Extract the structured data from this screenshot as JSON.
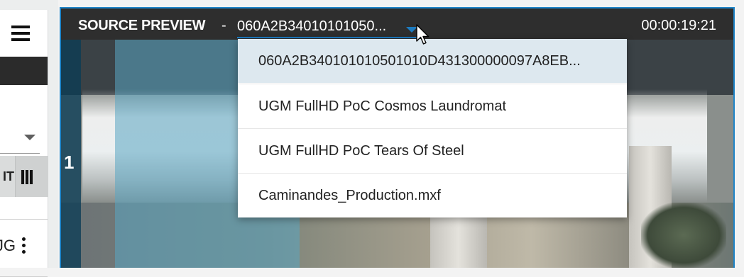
{
  "preview": {
    "title": "SOURCE PREVIEW",
    "separator": "-",
    "selected_source": "060A2B34010101050...",
    "timecode": "00:00:19:21",
    "track_number": "1"
  },
  "dropdown": {
    "options": [
      "060A2B340101010501010D431300000097A8EB...",
      "UGM FullHD PoC Cosmos Laundromat",
      "UGM FullHD PoC Tears Of Steel",
      "Caminandes_Production.mxf"
    ],
    "selected_index": 0
  },
  "left_panel": {
    "button_text": "IT",
    "item_text": "JG"
  },
  "colors": {
    "accent": "#1f84c8",
    "header_bg": "#2e2e2e",
    "selected_option_bg": "#dde8ef"
  },
  "icons": [
    "menu-icon",
    "chevron-down-icon",
    "columns-icon",
    "more-vertical-icon",
    "dropdown-arrow-icon",
    "mouse-pointer-icon"
  ]
}
